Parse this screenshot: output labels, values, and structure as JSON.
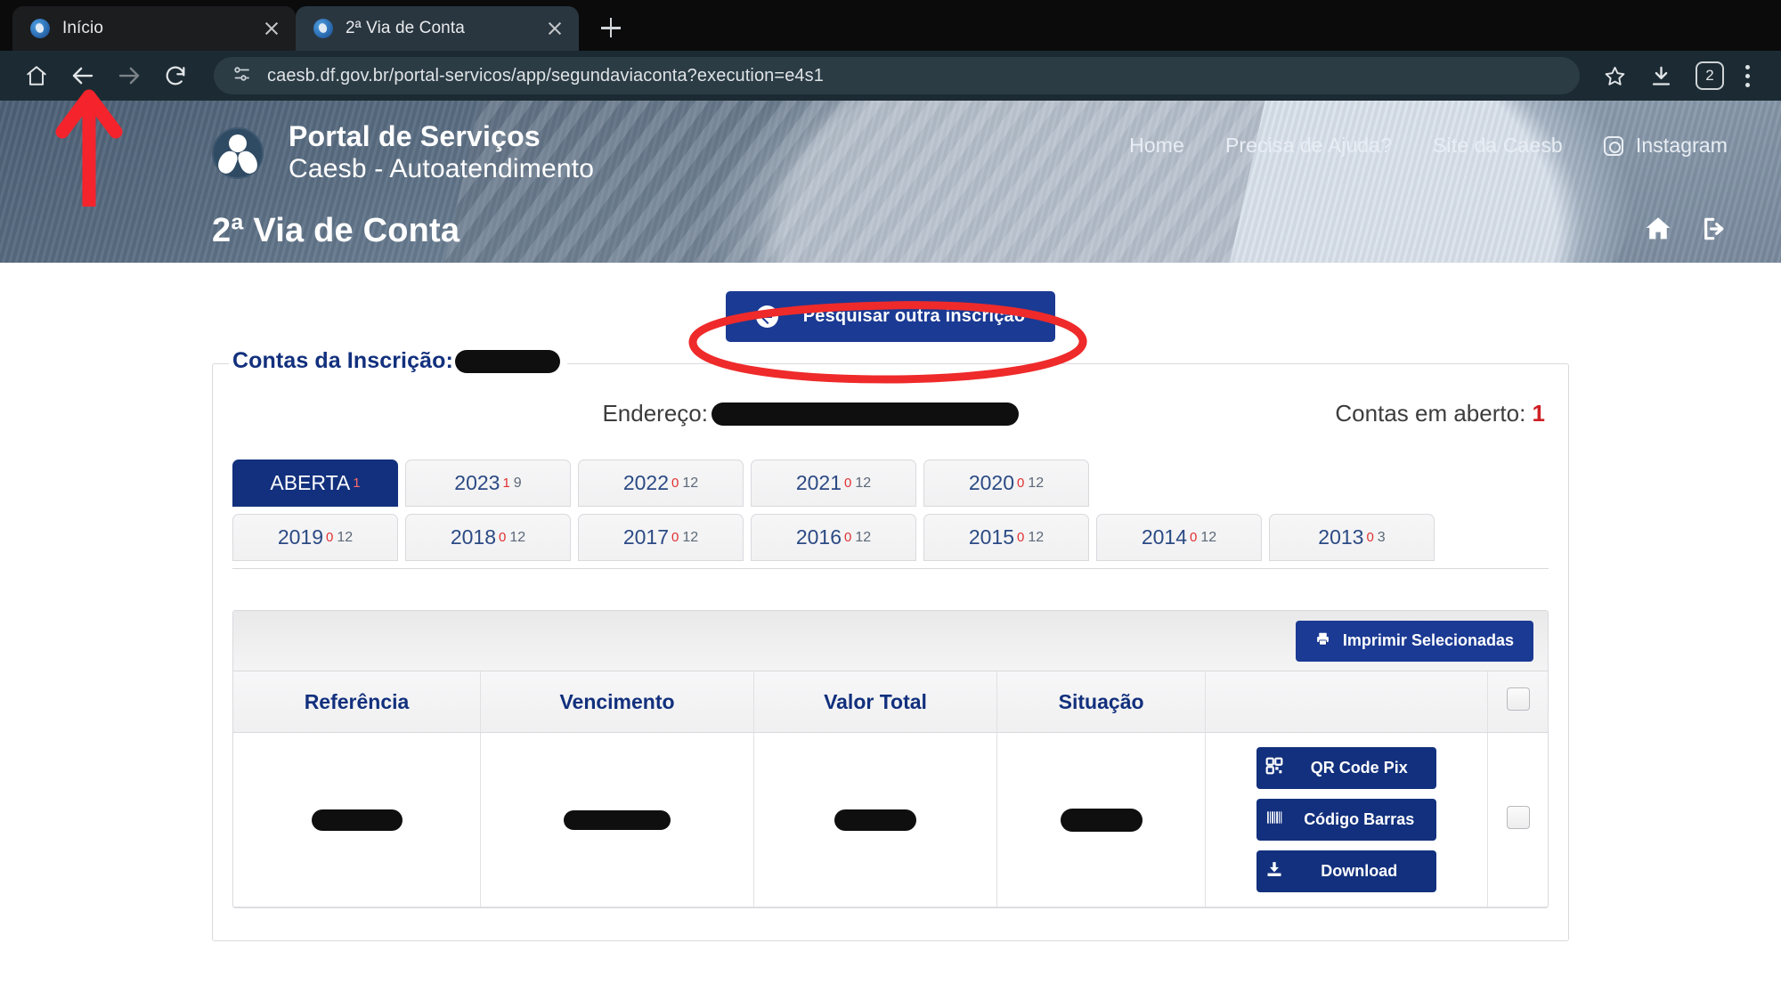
{
  "browser": {
    "tabs": [
      {
        "title": "Início",
        "active": false,
        "favicon": "caesb-favicon"
      },
      {
        "title": "2ª Via de Conta",
        "active": true,
        "favicon": "caesb-favicon"
      }
    ],
    "new_tab_label": "+",
    "url": "caesb.df.gov.br/portal-servicos/app/segundaviaconta?execution=e4s1",
    "profile_badge": "2",
    "toolbar_icons": [
      "home-icon",
      "back-icon",
      "forward-icon",
      "reload-icon",
      "site-info-icon",
      "bookmark-star-icon",
      "downloads-icon",
      "profile-badge",
      "kebab-menu-icon"
    ]
  },
  "header": {
    "brand_title": "Portal de Serviços",
    "brand_subtitle": "Caesb - Autoatendimento",
    "nav": [
      {
        "label": "Home"
      },
      {
        "label": "Precisa de Ajuda?"
      },
      {
        "label": "Site da Caesb"
      },
      {
        "label": "Instagram",
        "icon": "instagram-icon"
      }
    ],
    "page_title": "2ª Via de Conta",
    "title_icons": [
      "home-icon",
      "logout-icon"
    ]
  },
  "main": {
    "search_again_button": "Pesquisar outra inscrição",
    "fieldset_legend": "Contas da Inscrição:",
    "inscricao_value": "",
    "address_label": "Endereço:",
    "address_value": "",
    "open_accounts_label": "Contas em aberto:",
    "open_accounts_count": "1",
    "tabs_row_1": [
      {
        "label": "ABERTA",
        "sup": "1",
        "sub": "",
        "active": true
      },
      {
        "label": "2023",
        "sup": "1",
        "sub": "9",
        "active": false
      },
      {
        "label": "2022",
        "sup": "0",
        "sub": "12",
        "active": false
      },
      {
        "label": "2021",
        "sup": "0",
        "sub": "12",
        "active": false
      },
      {
        "label": "2020",
        "sup": "0",
        "sub": "12",
        "active": false
      }
    ],
    "tabs_row_2": [
      {
        "label": "2019",
        "sup": "0",
        "sub": "12",
        "active": false
      },
      {
        "label": "2018",
        "sup": "0",
        "sub": "12",
        "active": false
      },
      {
        "label": "2017",
        "sup": "0",
        "sub": "12",
        "active": false
      },
      {
        "label": "2016",
        "sup": "0",
        "sub": "12",
        "active": false
      },
      {
        "label": "2015",
        "sup": "0",
        "sub": "12",
        "active": false
      },
      {
        "label": "2014",
        "sup": "0",
        "sub": "12",
        "active": false
      },
      {
        "label": "2013",
        "sup": "0",
        "sub": "3",
        "active": false
      }
    ],
    "print_selected_button": "Imprimir Selecionadas",
    "table": {
      "columns": [
        "Referência",
        "Vencimento",
        "Valor Total",
        "Situação",
        "",
        ""
      ],
      "rows": [
        {
          "referencia": "",
          "vencimento": "",
          "valor_total": "",
          "situacao": "",
          "actions": [
            {
              "label": "QR Code Pix",
              "icon": "qr-code-icon"
            },
            {
              "label": "Código Barras",
              "icon": "barcode-icon"
            },
            {
              "label": "Download",
              "icon": "download-icon"
            }
          ],
          "selected": false
        }
      ]
    }
  },
  "annotations": {
    "arrow": {
      "name": "red-arrow-pointing-to-back-button",
      "color": "#f5232b"
    },
    "ellipse": {
      "name": "red-ellipse-around-search-again-button",
      "color": "#ef2a2a"
    }
  },
  "colors": {
    "brand_blue": "#12307d",
    "button_blue": "#1b3a93",
    "accent_red": "#cf2026",
    "annotation_red": "#f5232b",
    "chrome_dark": "#0c0c0d",
    "omnibox": "#2b3c45"
  }
}
